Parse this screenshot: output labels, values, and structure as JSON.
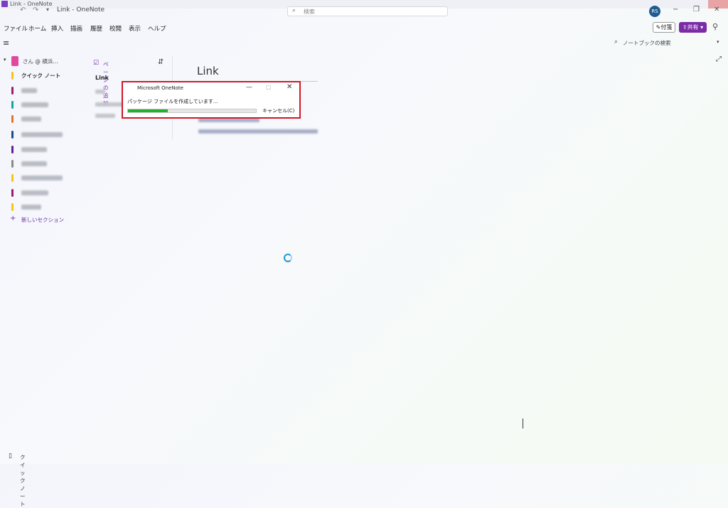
{
  "window": {
    "strip_title": "Link - OneNote",
    "app_title": "Link  -  OneNote",
    "search_placeholder": "検索",
    "avatar_initials": "RS",
    "minimize": "−",
    "restore": "❐",
    "close": "✕"
  },
  "menu": {
    "items": [
      "ファイル",
      "ホーム",
      "挿入",
      "描画",
      "履歴",
      "校閲",
      "表示",
      "ヘルプ"
    ],
    "fusen_label": "付箋",
    "share_label": "共有"
  },
  "toolbar": {
    "notebook_search_placeholder": "ノートブックの検索"
  },
  "sidebar": {
    "notebook_name": "さん @ 横浜…",
    "sections": [
      {
        "label": "クイック ノート",
        "color": "#f5c518"
      },
      {
        "label": "",
        "color": "#9b1b73"
      },
      {
        "label": "",
        "color": "#17a3a3"
      },
      {
        "label": "",
        "color": "#e0762b"
      },
      {
        "label": "",
        "color": "#1c4c8a"
      },
      {
        "label": "",
        "color": "#6a1b9a"
      },
      {
        "label": "",
        "color": "#8a8a8a"
      },
      {
        "label": "",
        "color": "#f5c518"
      },
      {
        "label": "",
        "color": "#9b1b73"
      },
      {
        "label": "",
        "color": "#f5c518"
      }
    ],
    "new_section": "新しいセクション",
    "quick_notes_bottom": "クイック ノート"
  },
  "pages": {
    "add_page": "ページの追加",
    "active_page": "Link"
  },
  "canvas": {
    "page_title": "Link"
  },
  "dialog": {
    "title": "Microsoft OneNote",
    "message": "パッケージ ファイルを作成しています...",
    "cancel": "キャンセル(C)",
    "progress": 0.31
  }
}
